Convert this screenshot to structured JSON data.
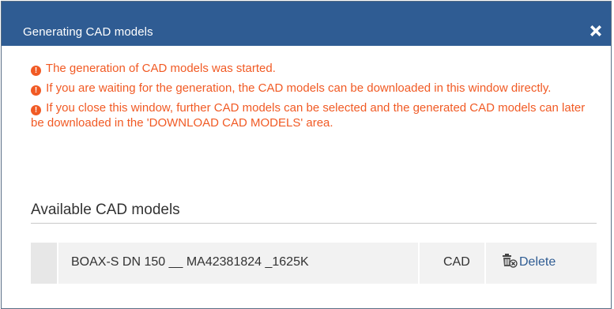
{
  "dialog": {
    "title": "Generating CAD models",
    "close_icon": "close-x-icon"
  },
  "messages": [
    {
      "icon": "warning-icon",
      "text": "The generation of CAD models was started."
    },
    {
      "icon": "warning-icon",
      "text": "If you are waiting for the generation, the CAD models can be downloaded in this window directly."
    },
    {
      "icon": "warning-icon",
      "text": "If you close this window, further CAD models can be selected and the generated CAD models can later be downloaded in the 'DOWNLOAD CAD MODELS' area."
    }
  ],
  "section": {
    "title": "Available CAD models"
  },
  "models": [
    {
      "name": "BOAX-S DN 150 __ MA42381824 _1625K",
      "type": "CAD",
      "action_label": "Delete",
      "action_icon": "trash-delete-icon"
    }
  ],
  "colors": {
    "header_bg": "#2f5c93",
    "message_text": "#f15a24",
    "link": "#2f5c93"
  }
}
